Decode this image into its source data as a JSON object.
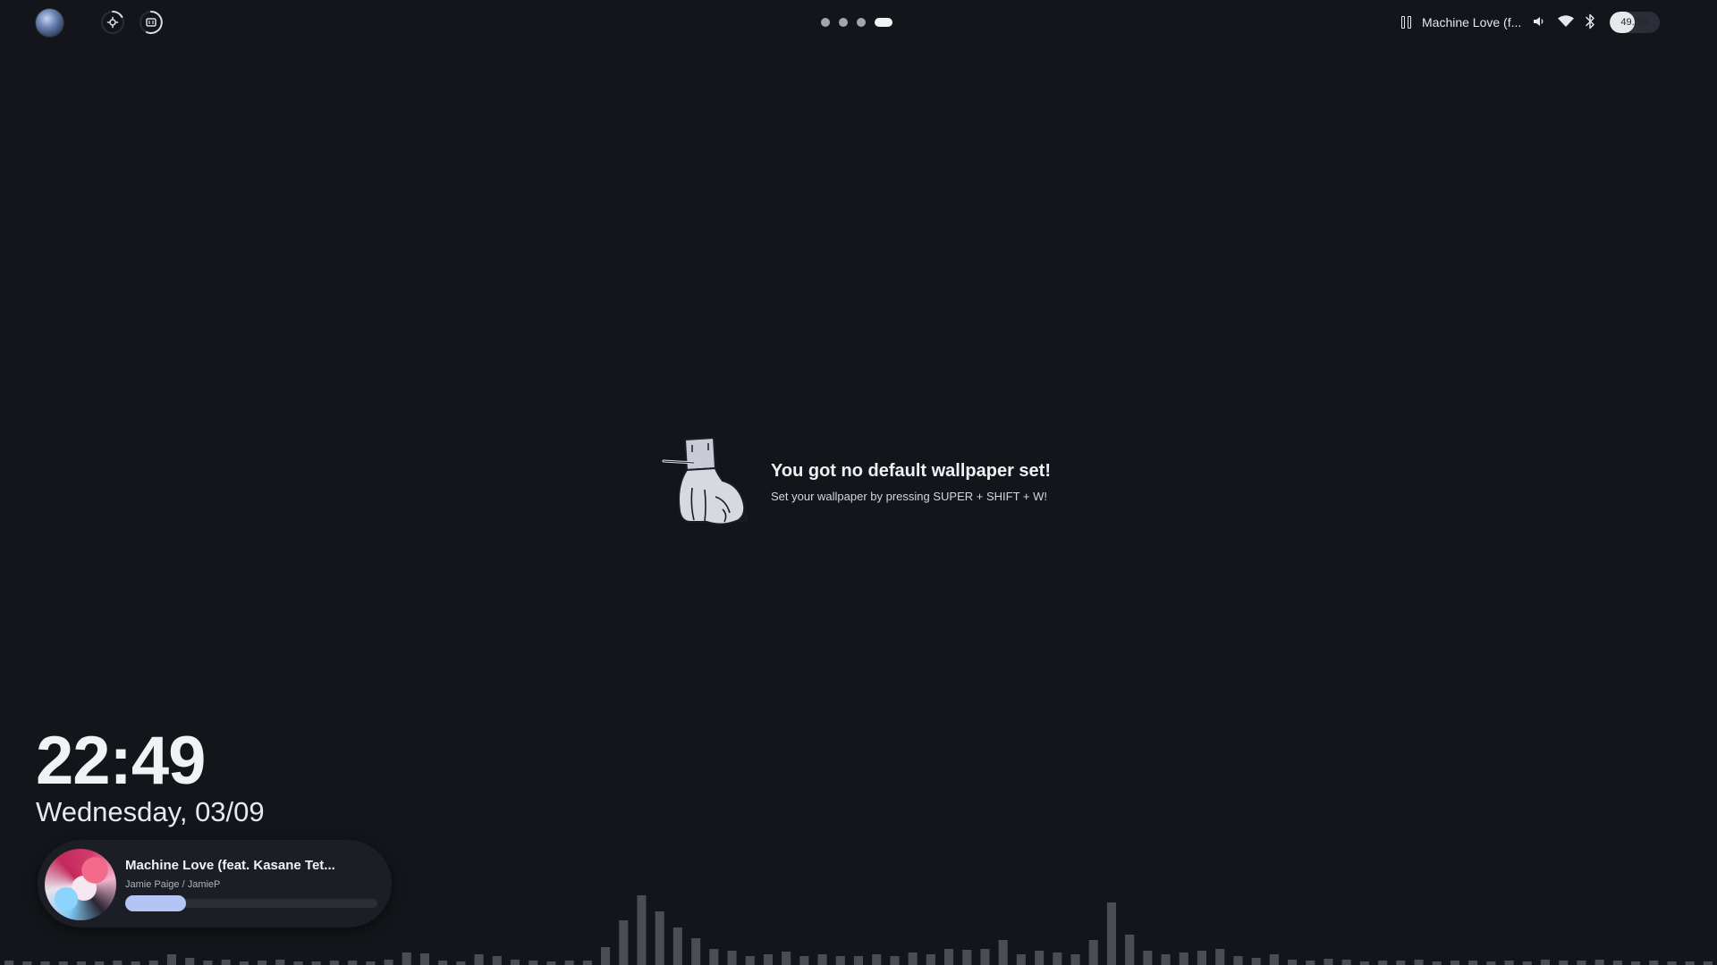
{
  "topbar": {
    "workspaces": [
      {
        "active": false
      },
      {
        "active": false
      },
      {
        "active": false
      },
      {
        "active": true
      }
    ],
    "media": {
      "state": "playing",
      "title_short": "Machine Love (f..."
    },
    "battery": {
      "percent_label": "49.5%",
      "level": 0.495
    },
    "icons": {
      "avatar": "user-avatar",
      "ring1": "gear-ring-icon",
      "ring2": "memory-ring-icon",
      "pause": "pause-icon",
      "volume": "volume-icon",
      "wifi": "wifi-icon",
      "bluetooth": "bluetooth-icon"
    }
  },
  "center_message": {
    "title": "You got no default wallpaper set!",
    "subtitle": "Set your wallpaper by pressing SUPER + SHIFT + W!"
  },
  "clock": {
    "time": "22:49",
    "date": "Wednesday, 03/09"
  },
  "now_playing": {
    "title": "Machine Love (feat. Kasane Tet...",
    "artist": "Jamie Paige / JamieP",
    "progress": 0.24
  },
  "visualizer": {
    "levels": [
      0.05,
      0.04,
      0.04,
      0.04,
      0.04,
      0.04,
      0.05,
      0.04,
      0.05,
      0.12,
      0.08,
      0.05,
      0.06,
      0.04,
      0.05,
      0.06,
      0.04,
      0.04,
      0.05,
      0.05,
      0.04,
      0.06,
      0.14,
      0.13,
      0.05,
      0.04,
      0.12,
      0.1,
      0.06,
      0.05,
      0.04,
      0.05,
      0.05,
      0.2,
      0.5,
      0.78,
      0.6,
      0.42,
      0.3,
      0.18,
      0.16,
      0.1,
      0.12,
      0.15,
      0.1,
      0.12,
      0.1,
      0.1,
      0.12,
      0.1,
      0.14,
      0.12,
      0.18,
      0.17,
      0.18,
      0.28,
      0.12,
      0.16,
      0.14,
      0.12,
      0.28,
      0.7,
      0.34,
      0.16,
      0.12,
      0.14,
      0.16,
      0.18,
      0.1,
      0.08,
      0.12,
      0.06,
      0.05,
      0.07,
      0.06,
      0.04,
      0.05,
      0.05,
      0.06,
      0.04,
      0.05,
      0.05,
      0.04,
      0.05,
      0.04,
      0.06,
      0.05,
      0.05,
      0.06,
      0.05,
      0.04,
      0.05,
      0.04,
      0.04,
      0.03
    ]
  },
  "colors": {
    "background": "#13151a",
    "accent": "#b4c4f4",
    "bar": "#4a4d56"
  }
}
